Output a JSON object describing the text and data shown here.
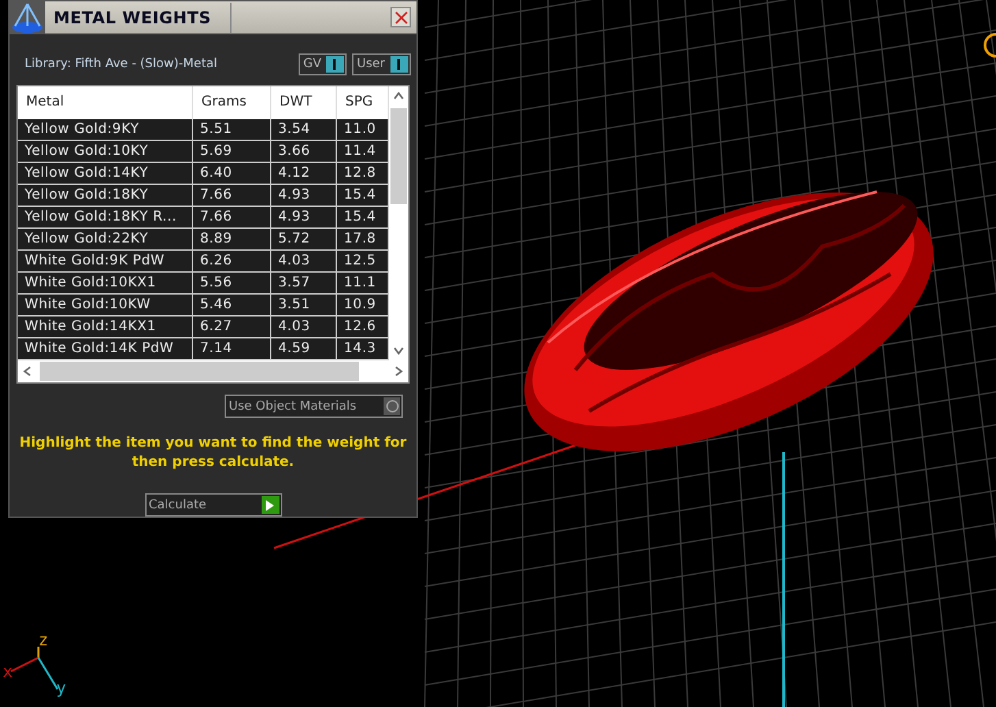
{
  "panel": {
    "title": "METAL WEIGHTS",
    "library": "Library: Fifth Ave - (Slow)-Metal",
    "toggles": [
      {
        "label": "GV",
        "on": true
      },
      {
        "label": "User",
        "on": true
      }
    ],
    "table": {
      "columns": [
        "Metal",
        "Grams",
        "DWT",
        "SPG"
      ],
      "rows": [
        {
          "cells": [
            "Yellow Gold:9KY",
            "5.51",
            "3.54",
            "11.0"
          ]
        },
        {
          "cells": [
            "Yellow Gold:10KY",
            "5.69",
            "3.66",
            "11.4"
          ]
        },
        {
          "cells": [
            "Yellow Gold:14KY",
            "6.40",
            "4.12",
            "12.8"
          ]
        },
        {
          "cells": [
            "Yellow Gold:18KY",
            "7.66",
            "4.93",
            "15.4"
          ]
        },
        {
          "cells": [
            "Yellow Gold:18KY R...",
            "7.66",
            "4.93",
            "15.4"
          ]
        },
        {
          "cells": [
            "Yellow Gold:22KY",
            "8.89",
            "5.72",
            "17.8"
          ]
        },
        {
          "cells": [
            "White Gold:9K PdW",
            "6.26",
            "4.03",
            "12.5"
          ]
        },
        {
          "cells": [
            "White Gold:10KX1",
            "5.56",
            "3.57",
            "11.1"
          ]
        },
        {
          "cells": [
            "White Gold:10KW",
            "5.46",
            "3.51",
            "10.9"
          ]
        },
        {
          "cells": [
            "White Gold:14KX1",
            "6.27",
            "4.03",
            "12.6"
          ]
        },
        {
          "cells": [
            "White Gold:14K PdW",
            "7.14",
            "4.59",
            "14.3"
          ]
        }
      ]
    },
    "use_object_materials": {
      "label": "Use Object Materials",
      "on": false
    },
    "instruction": "Highlight the item you want to find the weight for then press calculate.",
    "calculate_button": "Calculate"
  },
  "axis_labels": [
    "z",
    "x",
    "y"
  ]
}
